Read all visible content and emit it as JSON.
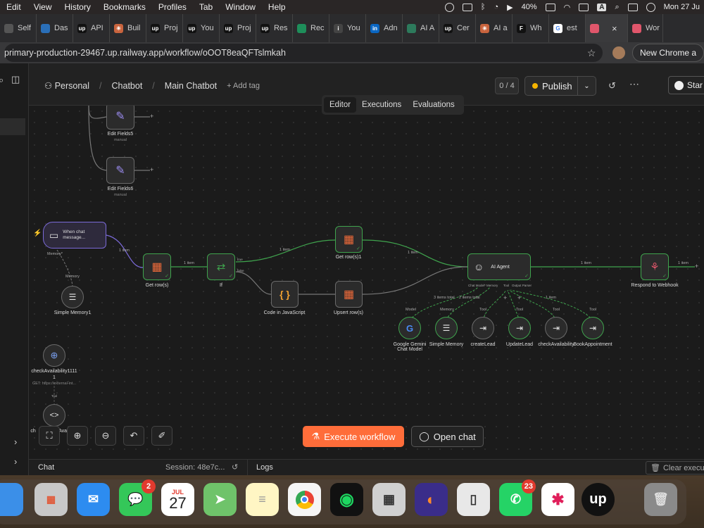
{
  "menubar": {
    "items": [
      "Edit",
      "View",
      "History",
      "Bookmarks",
      "Profiles",
      "Tab",
      "Window",
      "Help"
    ],
    "battery": "40%",
    "input_source": "A",
    "clock": "Mon 27 Ju"
  },
  "tabs": [
    {
      "label": "Self",
      "fav": "",
      "color": "#555555"
    },
    {
      "label": "Das",
      "fav": "",
      "color": "#2a6fb8"
    },
    {
      "label": "API",
      "fav": "up",
      "color": "#111111"
    },
    {
      "label": "Buil",
      "fav": "✳",
      "color": "#c9643e"
    },
    {
      "label": "Proj",
      "fav": "up",
      "color": "#111111"
    },
    {
      "label": "You",
      "fav": "up",
      "color": "#111111"
    },
    {
      "label": "Proj",
      "fav": "up",
      "color": "#111111"
    },
    {
      "label": "Res",
      "fav": "up",
      "color": "#111111"
    },
    {
      "label": "Rec",
      "fav": "",
      "color": "#1e8e5a"
    },
    {
      "label": "You",
      "fav": "i",
      "color": "#444444"
    },
    {
      "label": "Adn",
      "fav": "in",
      "color": "#0a66c2"
    },
    {
      "label": "AI A",
      "fav": "",
      "color": "#2d7a5c"
    },
    {
      "label": "Cer",
      "fav": "up",
      "color": "#111111"
    },
    {
      "label": "AI a",
      "fav": "✳",
      "color": "#c9643e"
    },
    {
      "label": "Wh",
      "fav": "F",
      "color": "#111111"
    },
    {
      "label": "est",
      "fav": "G",
      "color": "#ffffff"
    },
    {
      "label": "",
      "fav": "",
      "color": "#e0566b",
      "active": true
    },
    {
      "label": "Wor",
      "fav": "",
      "color": "#e0566b"
    }
  ],
  "address": {
    "url": "primary-production-29467.up.railway.app/workflow/oOOT8eaQFTslmkah",
    "new_chrome": "New Chrome a"
  },
  "header": {
    "breadcrumb": {
      "personal": "Personal",
      "project": "Chatbot",
      "workflow": "Main Chatbot",
      "add_tag": "+ Add tag"
    },
    "counter": "0 / 4",
    "publish": "Publish",
    "star": "Star"
  },
  "view_tabs": [
    "Editor",
    "Executions",
    "Evaluations"
  ],
  "nodes": {
    "edit5": {
      "label": "Edit Fields5",
      "sub": "manual"
    },
    "edit6": {
      "label": "Edit Fields6",
      "sub": "manual"
    },
    "trigger": {
      "label": "When chat message...",
      "port": "Memory*"
    },
    "simple_memory1": {
      "label": "Simple Memory1",
      "port": "Memory"
    },
    "get_rows": {
      "label": "Get row(s)"
    },
    "if": {
      "label": "If",
      "true": "true",
      "false": "false"
    },
    "get_rows1": {
      "label": "Get row(s)1"
    },
    "code": {
      "label": "Code in JavaScript"
    },
    "upsert": {
      "label": "Upsert row(s)"
    },
    "ai_agent": {
      "label": "AI Agent",
      "ports": [
        "Chat Model*",
        "Memory",
        "Tool",
        "Output Parser"
      ]
    },
    "respond": {
      "label": "Respond to Webhook"
    },
    "gemini": {
      "label": "Google Gemini Chat Model",
      "port": "Model"
    },
    "simple_memory": {
      "label": "Simple Memory",
      "port": "Memory"
    },
    "create_lead": {
      "label": "createLead",
      "port": "Tool"
    },
    "update_lead": {
      "label": "UpdateLead",
      "port": "Tool"
    },
    "check_availability": {
      "label": "checkAvailability",
      "port": "Tool"
    },
    "book_appointment": {
      "label": "BookAppointment",
      "port": "Tool"
    },
    "check_availability_1111": {
      "label": "checkAvailability1111",
      "label2": "1",
      "sub": "GET: https://external-int..."
    },
    "check_bottom": {
      "label": "checkAvailabili",
      "label_prefix": "ch",
      "port": "Tool"
    }
  },
  "edges": {
    "one_item": "1 item",
    "items_total_3": "3 items total",
    "items_total_2": "2 items total",
    "one_item_tool": "1 item"
  },
  "actions": {
    "execute": "Execute workflow",
    "open_chat": "Open chat"
  },
  "bottom": {
    "chat": "Chat",
    "session": "Session: 48e7c...",
    "logs": "Logs",
    "clear": "Clear executi"
  },
  "dock": {
    "calendar_month": "JUL",
    "calendar_day": "27",
    "messages_badge": "2",
    "whatsapp_badge": "23"
  },
  "colors": {
    "accent": "#ff6d3a",
    "success": "#3fa34d",
    "trigger": "#7b6ad8",
    "publish_dot": "#f5b400"
  }
}
